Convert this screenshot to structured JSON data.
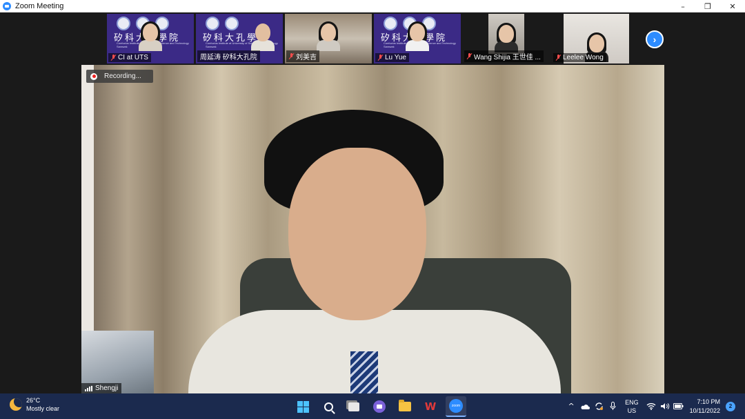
{
  "window": {
    "title": "Zoom Meeting",
    "controls": [
      "–",
      "❐",
      "✕"
    ]
  },
  "participants": [
    {
      "name": "CI at UTS",
      "muted": true,
      "banner": "矽科大孔學院",
      "subtitle": "Confucius Institute at University of Science and Technology Sarawak"
    },
    {
      "name": "周延涛 矽科大孔院",
      "muted": false,
      "banner": "矽科大孔學院",
      "subtitle": "Confucius Institute at University of Science and Technology Sarawak"
    },
    {
      "name": "刘美吉",
      "muted": true
    },
    {
      "name": "Lu Yue",
      "muted": true,
      "banner": "矽科大孔學院",
      "subtitle": "Confucius Institute at University of Science and Technology Sarawak"
    },
    {
      "name": "Wang Shijia 王世佳 ...",
      "muted": true
    },
    {
      "name": "Leelee Wong",
      "muted": true
    }
  ],
  "next_page_label": "›",
  "main_video": {
    "recording_label": "Recording...",
    "active_speaker": "Shengji"
  },
  "taskbar": {
    "weather_temp": "26°C",
    "weather_desc": "Mostly clear",
    "wps_label": "W",
    "zoom_label": "zoom",
    "lang_top": "ENG",
    "lang_bottom": "US",
    "time": "7:10 PM",
    "date": "10/11/2022",
    "notification_count": "2",
    "tray_symbols": {
      "chevron": "^",
      "mic": "🎤",
      "wifi": "◠",
      "volume": "🔊",
      "battery": "▭"
    }
  },
  "colors": {
    "zoom_blue": "#2d8cff",
    "banner_purple": "#3b2a86",
    "taskbar": "#1b2a4e",
    "muted_red": "#ff4d4d"
  }
}
